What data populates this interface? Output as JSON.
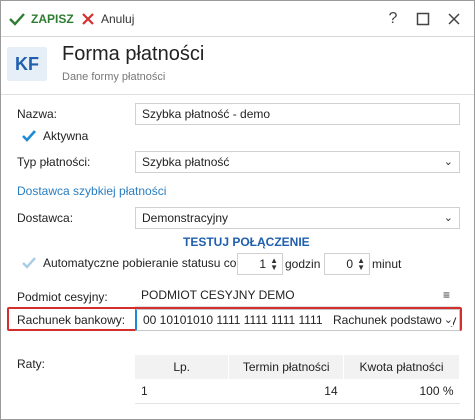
{
  "toolbar": {
    "save_label": "ZAPISZ",
    "cancel_label": "Anuluj",
    "help_label": "?"
  },
  "header": {
    "avatar_text": "KF",
    "title": "Forma płatności",
    "subtitle": "Dane formy płatności"
  },
  "form": {
    "name_label": "Nazwa:",
    "name_value": "Szybka płatność - demo",
    "active_label": "Aktywna",
    "type_label": "Typ płatności:",
    "type_value": "Szybka płatność",
    "provider_section_title": "Dostawca szybkiej płatności",
    "provider_label": "Dostawca:",
    "provider_value": "Demonstracyjny",
    "test_connection_label": "TESTUJ POŁĄCZENIE",
    "auto_status_label": "Automatyczne pobieranie statusu co",
    "hours_value": "1",
    "hours_unit": "godzin",
    "minutes_value": "0",
    "minutes_unit": "minut",
    "assignee_label": "Podmiot cesyjny:",
    "assignee_value": "PODMIOT CESYJNY DEMO",
    "bank_account_label": "Rachunek bankowy:",
    "bank_account_value": "00 10101010 1111 1111 1111 1111",
    "bank_account_type": "Rachunek podstawowy",
    "installments_label": "Raty:"
  },
  "installments_table": {
    "columns": [
      "Lp.",
      "Termin płatności",
      "Kwota płatności"
    ],
    "rows": [
      [
        "1",
        "14",
        "100 %"
      ]
    ]
  },
  "colors": {
    "save_green": "#2e7d32",
    "cancel_red": "#d32f2f",
    "link_blue": "#2a7dc0",
    "check_blue": "#1f8ad4",
    "highlight_red": "#d32f2f"
  }
}
